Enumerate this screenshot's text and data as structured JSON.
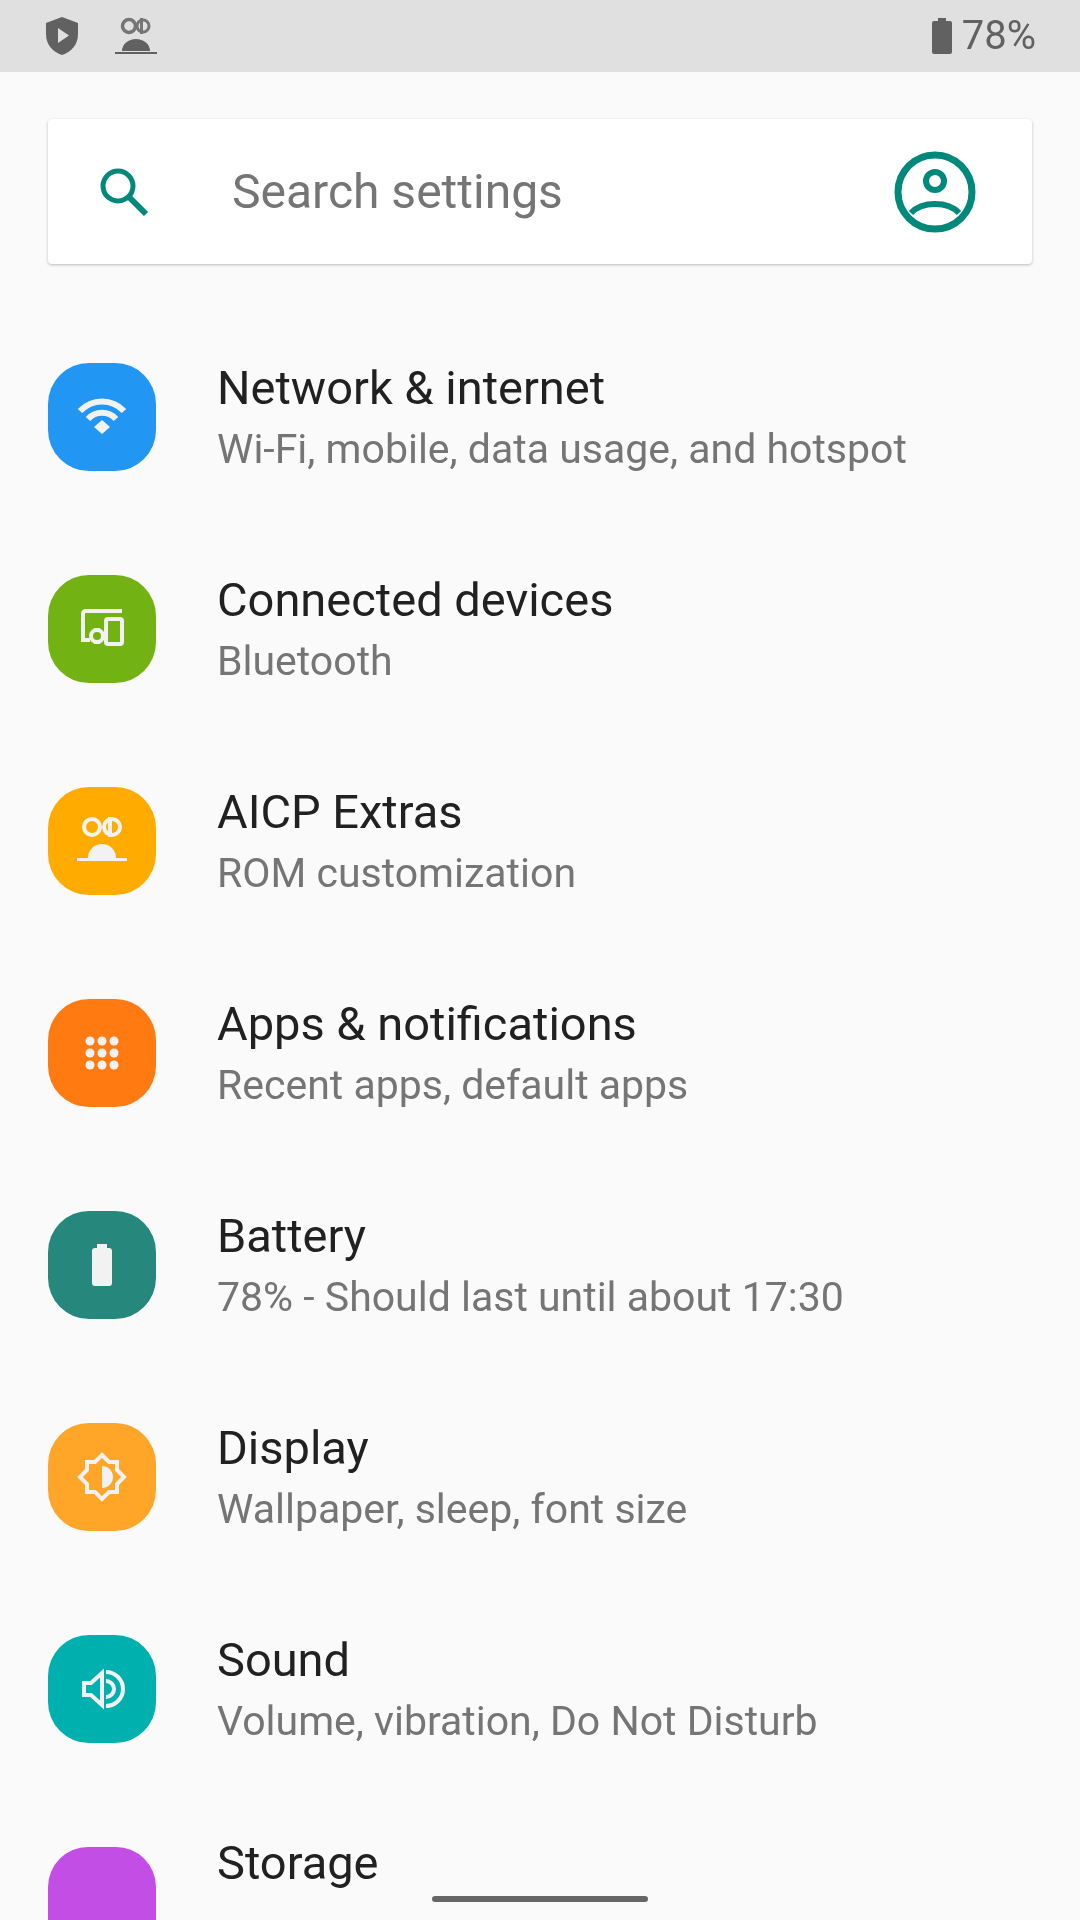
{
  "status_bar": {
    "battery_text": "78%"
  },
  "search": {
    "placeholder": "Search settings"
  },
  "items": [
    {
      "title": "Network & internet",
      "subtitle": "Wi-Fi, mobile, data usage, and hotspot",
      "color": "#2196f3"
    },
    {
      "title": "Connected devices",
      "subtitle": "Bluetooth",
      "color": "#72b313"
    },
    {
      "title": "AICP Extras",
      "subtitle": "ROM customization",
      "color": "#ffab00"
    },
    {
      "title": "Apps & notifications",
      "subtitle": "Recent apps, default apps",
      "color": "#ff7b12"
    },
    {
      "title": "Battery",
      "subtitle": "78% - Should last until about 17:30",
      "color": "#26887d"
    },
    {
      "title": "Display",
      "subtitle": "Wallpaper, sleep, font size",
      "color": "#ffa528"
    },
    {
      "title": "Sound",
      "subtitle": "Volume, vibration, Do Not Disturb",
      "color": "#00b0ae"
    },
    {
      "title": "Storage",
      "color": "#c24ee6"
    }
  ]
}
